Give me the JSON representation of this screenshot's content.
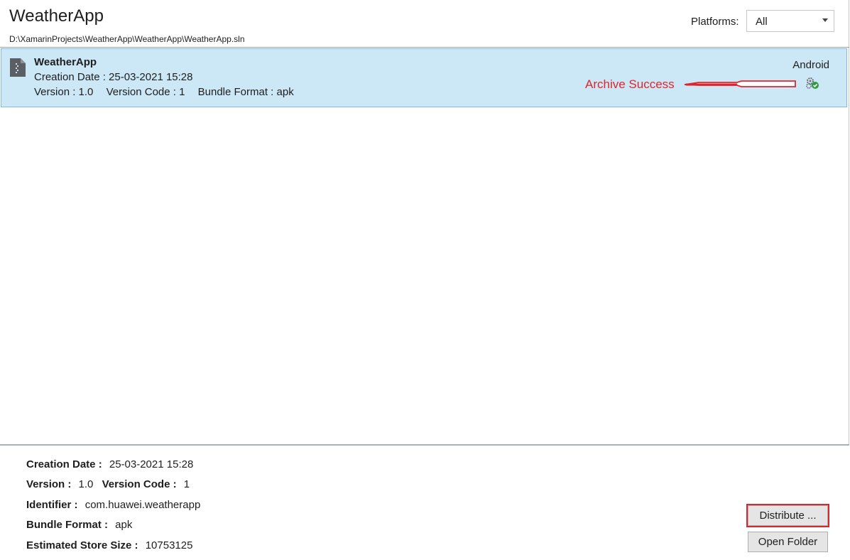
{
  "header": {
    "title": "WeatherApp",
    "solution_path": "D:\\XamarinProjects\\WeatherApp\\WeatherApp\\WeatherApp.sln",
    "platforms_label": "Platforms:",
    "platforms_value": "All"
  },
  "archive": {
    "name": "WeatherApp",
    "creation_date": "Creation Date :  25-03-2021 15:28",
    "version": "Version :  1.0",
    "version_code": "Version Code :  1",
    "bundle_format": "Bundle Format :  apk",
    "platform": "Android",
    "status_icon": "gear-check-icon"
  },
  "annotation": {
    "text": "Archive Success",
    "color": "#e0242c"
  },
  "details": {
    "creation_date_label": "Creation Date :",
    "creation_date_value": "25-03-2021 15:28",
    "version_label": "Version :",
    "version_value": "1.0",
    "version_code_label": "Version Code :",
    "version_code_value": "1",
    "identifier_label": "Identifier :",
    "identifier_value": "com.huawei.weatherapp",
    "bundle_format_label": "Bundle Format :",
    "bundle_format_value": "apk",
    "store_size_label": "Estimated Store Size :",
    "store_size_value": "10753125"
  },
  "actions": {
    "distribute_label": "Distribute ...",
    "open_folder_label": "Open Folder"
  },
  "colors": {
    "selection_bg": "#cce8f6",
    "selection_border": "#7fbde6",
    "annotation_red": "#e0242c"
  }
}
